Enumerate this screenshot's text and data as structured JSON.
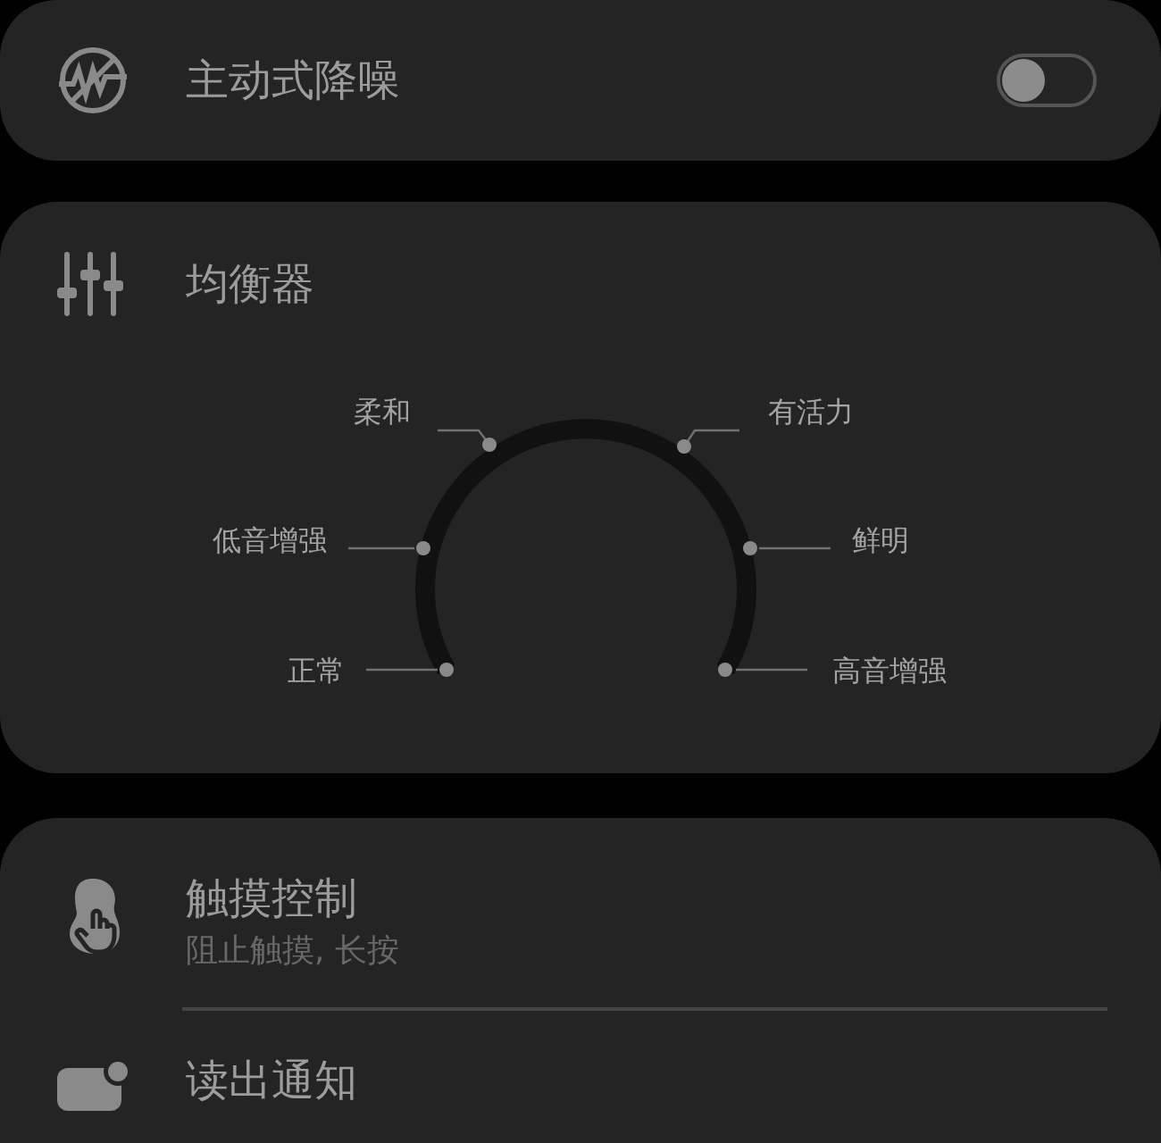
{
  "noise_cancelling": {
    "title": "主动式降噪",
    "on": false
  },
  "equalizer": {
    "title": "均衡器",
    "presets": [
      {
        "label": "正常"
      },
      {
        "label": "低音增强"
      },
      {
        "label": "柔和"
      },
      {
        "label": "有活力"
      },
      {
        "label": "鲜明"
      },
      {
        "label": "高音增强"
      }
    ]
  },
  "settings": [
    {
      "kind": "touch",
      "title": "触摸控制",
      "subtitle": "阻止触摸, 长按"
    },
    {
      "kind": "notify",
      "title": "读出通知"
    }
  ]
}
